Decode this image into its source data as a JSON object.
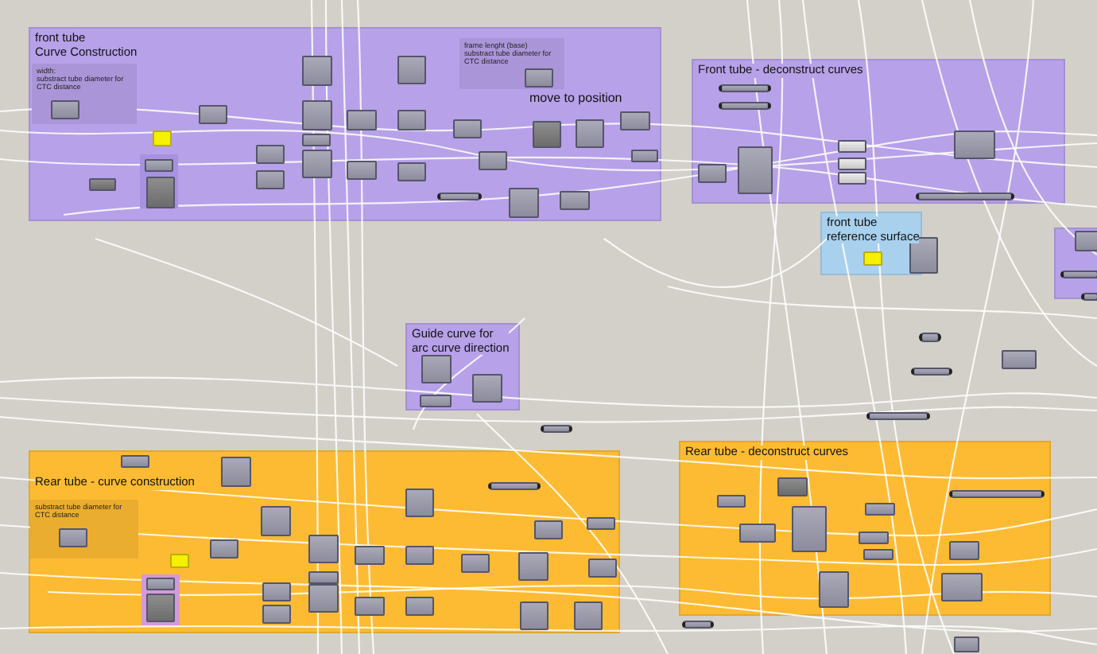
{
  "canvas": {
    "groups": [
      {
        "title": "front tube\nCurve Construction",
        "color": "#b7a1e9",
        "notes": [
          {
            "text": "width:\nsubstract tube diameter for\nCTC distance"
          },
          {
            "text": "frame lenght (base)\nsubstract tube diameter for\nCTC distance"
          }
        ],
        "labels": [
          {
            "text": "move to position"
          }
        ]
      },
      {
        "title": "Front tube - deconstruct curves",
        "color": "#b7a1e9"
      },
      {
        "title": "front tube\nreference surface",
        "color": "#a9d1ee"
      },
      {
        "title": "Guide curve for\narc curve direction",
        "color": "#b7a1e9"
      },
      {
        "title": "Rear tube - curve construction",
        "color": "#fcbb33",
        "notes": [
          {
            "text": "substract tube diameter for\nCTC distance"
          }
        ]
      },
      {
        "title": "Rear tube - deconstruct curves",
        "color": "#fcbb33"
      },
      {
        "color": "#b7a1e9"
      }
    ]
  }
}
